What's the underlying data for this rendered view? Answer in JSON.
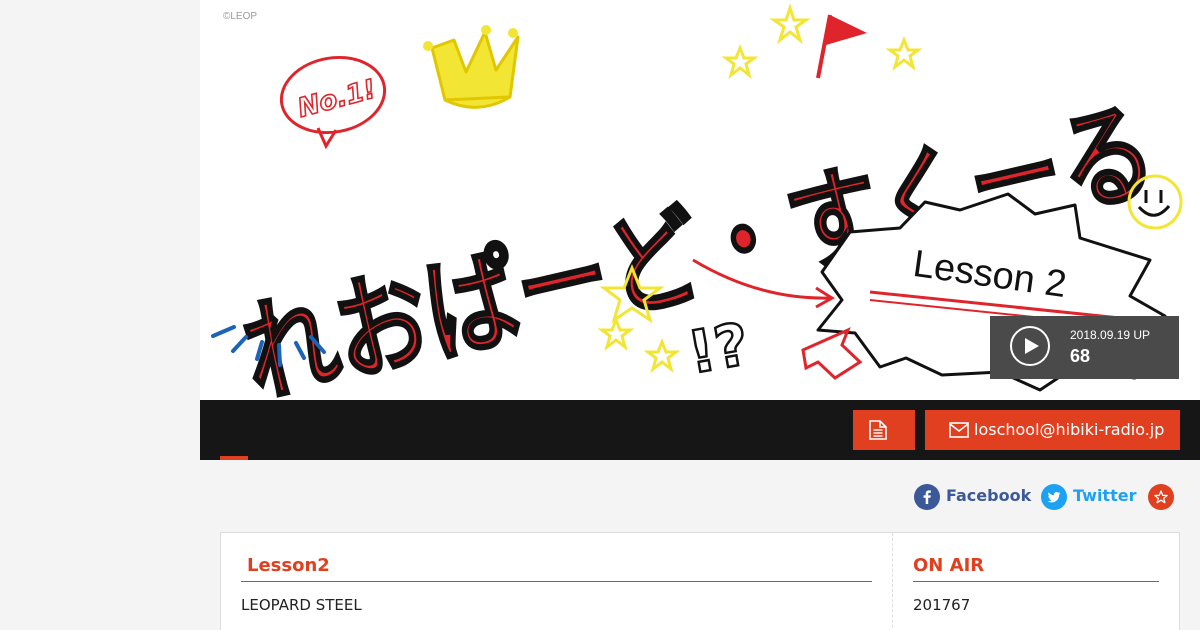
{
  "banner": {
    "copyright": "©LEOP",
    "title_art": "れおぱーど・すくーる",
    "badge_text": "No.1!",
    "lesson_text": "Lesson 2",
    "exclaim_text": "!?",
    "colors": {
      "red": "#e0242b",
      "yellow": "#f3e533",
      "blue": "#1b64b7"
    }
  },
  "episode": {
    "date": "2018.09.19 UP",
    "number": "68",
    "play_icon": "play-icon"
  },
  "toolbar": {
    "doc_icon": "document-icon",
    "mail_icon": "mail-icon",
    "mail_address": "loschool@hibiki-radio.jp"
  },
  "share": {
    "facebook_label": "Facebook",
    "twitter_label": "Twitter",
    "favorite_icon": "star-icon"
  },
  "info": {
    "lesson_heading": "Lesson2",
    "lesson_value": "LEOPARD STEEL",
    "onair_heading": "ON AIR",
    "onair_value": "201767"
  },
  "colors": {
    "accent": "#e0401f",
    "bar": "#161616",
    "page_bg": "#f4f4f4",
    "facebook": "#3b5998",
    "twitter": "#1da1f2"
  }
}
